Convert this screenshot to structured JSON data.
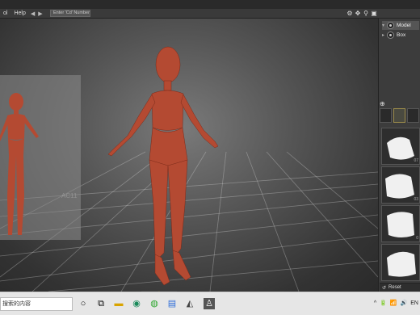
{
  "menu": {
    "items": [
      "ol",
      "Help"
    ],
    "back_glyph": "◀",
    "forward_glyph": "▶"
  },
  "search": {
    "placeholder": "Enter 'Cd' Number"
  },
  "toolbar_icons": [
    "settings-icon",
    "rotate-icon",
    "zoom-icon",
    "camera-icon"
  ],
  "viewport": {
    "reference_label": "AC11"
  },
  "scene": {
    "items": [
      {
        "label": "Model",
        "selected": true
      },
      {
        "label": "Box",
        "selected": false
      }
    ]
  },
  "presets": [
    {
      "number": "07"
    },
    {
      "number": "03"
    },
    {
      "number": "0"
    },
    {
      "number": ""
    }
  ],
  "reset_label": "Reset",
  "taskbar": {
    "search_text": "搜索的内容",
    "icons": [
      "circle-search-icon",
      "task-view-icon",
      "file-explorer-icon",
      "edge-icon",
      "wechat-icon",
      "store-icon",
      "app-icon",
      "character-app-icon"
    ],
    "tray_glyphs": [
      "^",
      "🔋",
      "📶",
      "🔊",
      "EN"
    ]
  },
  "colors": {
    "accent": "#ffcc33",
    "figure": "#b44a32"
  }
}
